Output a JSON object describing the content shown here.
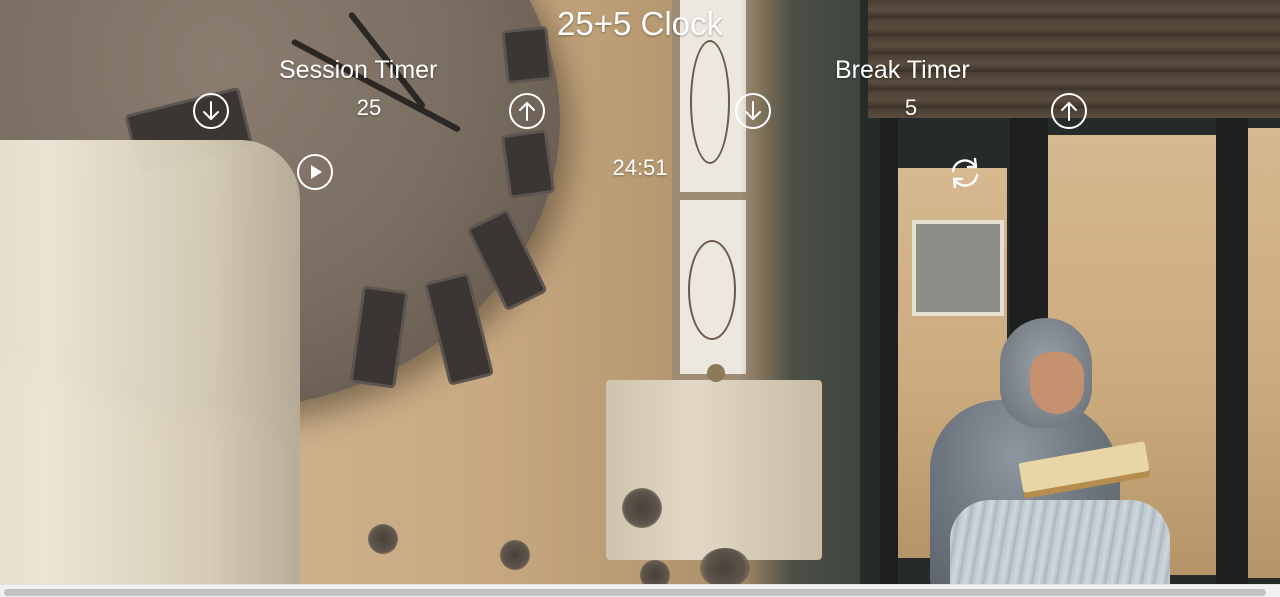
{
  "app": {
    "title": "25+5 Clock"
  },
  "session": {
    "label": "Session Timer",
    "length": "25"
  },
  "break": {
    "label": "Break Timer",
    "length": "5"
  },
  "timer": {
    "time_left": "24:51"
  },
  "icons": {
    "session_decrement": "arrow-down-circle-icon",
    "session_increment": "arrow-up-circle-icon",
    "break_decrement": "arrow-down-circle-icon",
    "break_increment": "arrow-up-circle-icon",
    "start_stop": "play-circle-icon",
    "reset": "refresh-icon"
  },
  "colors": {
    "text": "#ffffff",
    "scrollbar_track": "#f1f1f1",
    "scrollbar_thumb": "#c1c1c1"
  }
}
